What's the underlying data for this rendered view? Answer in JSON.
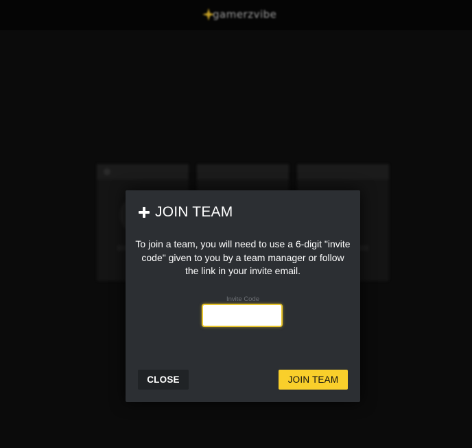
{
  "header": {
    "logo_icon": "sparkle-logo-icon",
    "logo_text": "gamerzvibe"
  },
  "modal": {
    "icon": "plus-icon",
    "title": "JOIN TEAM",
    "description": "To join a team, you will need to use a 6-digit \"invite code\" given to you by a team manager or follow the link in your invite email.",
    "invite_field": {
      "label": "Invite Code",
      "value": "",
      "placeholder": ""
    },
    "close_label": "CLOSE",
    "join_label": "JOIN TEAM"
  },
  "colors": {
    "accent": "#f9cf2b",
    "modal_bg": "#2c2f33",
    "close_bg": "#202326",
    "page_bg": "#0a0a0a"
  }
}
